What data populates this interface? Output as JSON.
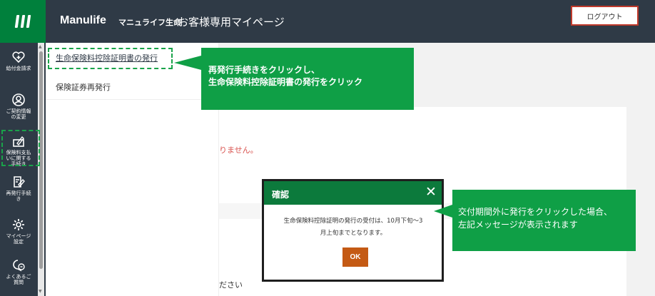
{
  "header": {
    "brand": "Manulife",
    "brand_sub": "マニュライフ生命",
    "page_title": "お客様専用マイページ",
    "logout_label": "ログアウト"
  },
  "sidebar": {
    "items": [
      {
        "label": "給付金請求",
        "icon": "heart-plus-icon"
      },
      {
        "label": "ご契約情報\nの変更",
        "icon": "user-circle-icon"
      },
      {
        "label": "保険料支払\nいに関する\n手続き",
        "icon": "payment-edit-icon"
      },
      {
        "label": "再発行手続\nき",
        "icon": "document-edit-icon"
      },
      {
        "label": "マイページ\n設定",
        "icon": "gear-icon"
      },
      {
        "label": "よくあるご\n質問",
        "icon": "chat-question-icon"
      }
    ]
  },
  "submenu": {
    "items": [
      {
        "label": "生命保険料控除証明書の発行"
      },
      {
        "label": "保険証券再発行"
      }
    ]
  },
  "content": {
    "error_fragment": "りません。",
    "bottom_fragment": "ださい"
  },
  "callouts": {
    "reissue_line1": "再発行手続きをクリックし、",
    "reissue_line2": "生命保険料控除証明書の発行をクリック",
    "message_line1": "交付期間外に発行をクリックした場合、",
    "message_line2": "左記メッセージが表示されます"
  },
  "modal": {
    "title": "確認",
    "close": "✕",
    "message_line1": "生命保険料控除証明の発行の受付は、10月下旬～3",
    "message_line2": "月上旬までとなります。",
    "ok_label": "OK"
  },
  "colors": {
    "header_bg": "#2f3a46",
    "brand_green": "#00803c",
    "callout_green": "#0f9f46",
    "modal_header": "#0c7a3c",
    "ok_button": "#c45a14",
    "logout_border": "#c0392b",
    "error_text": "#d9534f"
  }
}
